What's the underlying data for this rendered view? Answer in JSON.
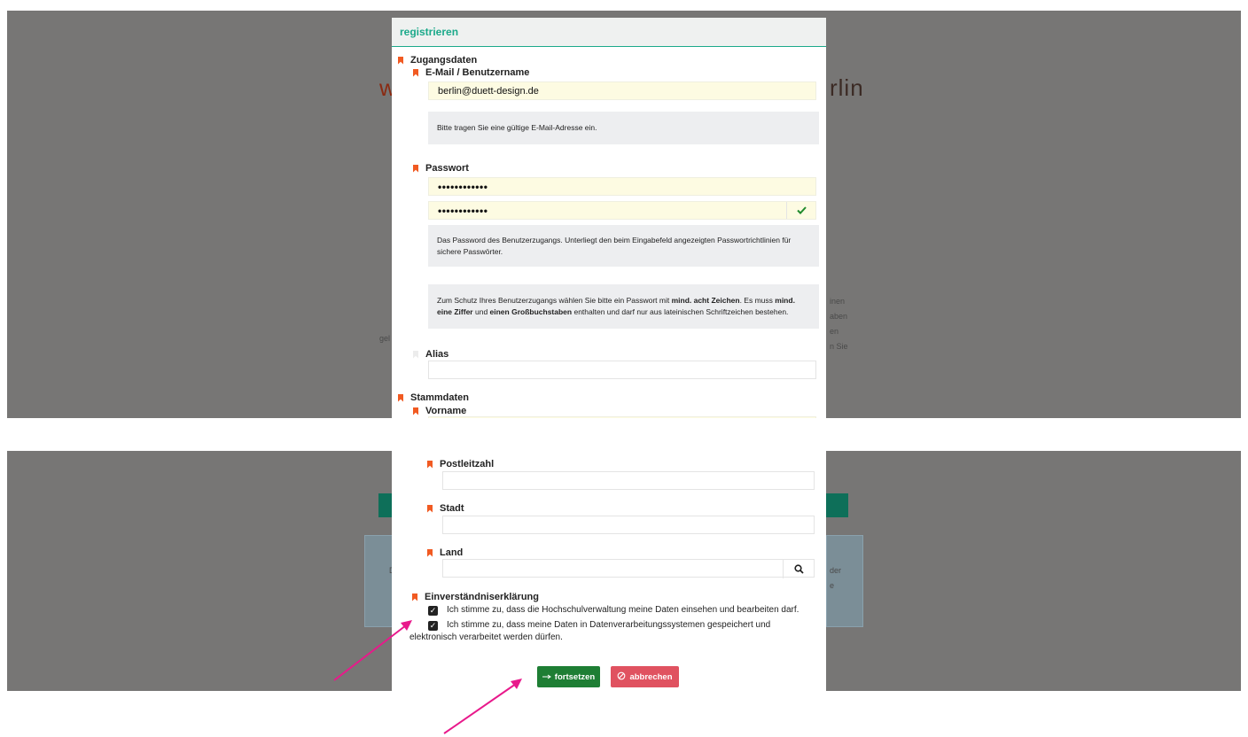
{
  "modal": {
    "title": "registrieren"
  },
  "sections": {
    "zugangsdaten": "Zugangsdaten",
    "stammdaten": "Stammdaten",
    "einverstaendnis": "Einverständniserklärung"
  },
  "fields": {
    "email": {
      "label": "E-Mail / Benutzername",
      "value": "berlin@duett-design.de"
    },
    "email_hint": "Bitte tragen Sie eine gültige E-Mail-Adresse ein.",
    "password": {
      "label": "Passwort",
      "value": "••••••••••••",
      "confirm_value": "••••••••••••"
    },
    "password_hint": "Das Password des Benutzerzugangs. Unterliegt den beim Eingabefeld angezeigten Passwortrichtlinien für sichere Passwörter.",
    "password_rule": {
      "part1": "Zum Schutz Ihres Benutzerzugangs wählen Sie bitte ein Passwort mit ",
      "bold1": "mind. acht Zeichen",
      "part2": ". Es muss ",
      "bold2": "mind. eine Ziffer",
      "part3": " und ",
      "bold3": "einen Großbuchstaben",
      "part4": " enthalten und darf nur aus lateinischen Schriftzeichen bestehen."
    },
    "alias": {
      "label": "Alias",
      "value": ""
    },
    "vorname": {
      "label": "Vorname"
    },
    "postleitzahl": {
      "label": "Postleitzahl",
      "value": ""
    },
    "stadt": {
      "label": "Stadt",
      "value": ""
    },
    "land": {
      "label": "Land",
      "value": ""
    }
  },
  "consents": [
    {
      "checked": true,
      "text": "Ich stimme zu, dass die Hochschulverwaltung meine Daten einsehen und bearbeiten darf."
    },
    {
      "checked": true,
      "text1": "Ich stimme zu, dass meine Daten in Datenverarbeitungssystemen gespeichert und",
      "text2": "elektronisch verarbeitet werden dürfen."
    }
  ],
  "buttons": {
    "continue": "fortsetzen",
    "cancel": "abbrechen"
  },
  "background": {
    "heading_left": "w",
    "heading_right": "rlin",
    "right_lines": [
      "inen",
      "aben",
      "en",
      "n Sie"
    ],
    "left_line": "gel",
    "shot2_left": "D",
    "shot2_right_lines": [
      "der",
      "e"
    ]
  },
  "icons": {
    "check": "check-icon",
    "search": "search-icon",
    "arrow": "arrow-right-icon",
    "cancel": "cancel-circle-icon",
    "checkbox": "checkbox-checked-icon"
  },
  "colors": {
    "accent": "#1ba98a",
    "bookmark": "#f15a22",
    "continue": "#1e7e34",
    "cancel": "#e05260",
    "annotation_arrow": "#e8198b"
  }
}
